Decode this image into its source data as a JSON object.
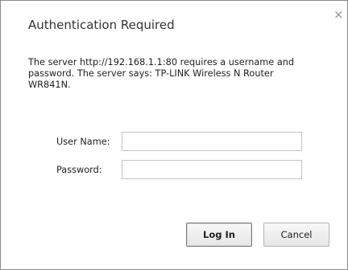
{
  "dialog": {
    "title": "Authentication Required",
    "close_glyph": "×",
    "close_icon": "close-icon",
    "message_lines": [
      "The server http://192.168.1.1:80 requires a username and",
      "password. The server says: TP-LINK Wireless N Router",
      "WR841N."
    ],
    "username_label": "User Name:",
    "username_value": "",
    "password_label": "Password:",
    "password_value": "",
    "login_label": "Log In",
    "cancel_label": "Cancel"
  }
}
